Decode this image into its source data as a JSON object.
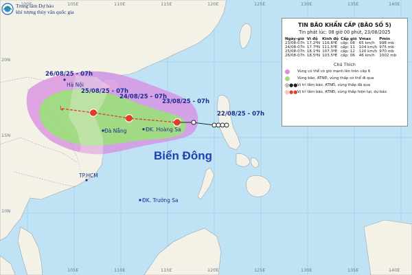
{
  "brand": {
    "line1": "Trung tâm Dự báo",
    "line2": "khí tượng thủy văn quốc gia"
  },
  "bulletin": {
    "title": "TIN BÃO KHẨN CẤP (BÃO SỐ 5)",
    "issued": "Tin phát lúc: 08 giờ 00 phút, 23/08/2025",
    "columns": [
      "Ngày-giờ",
      "Vĩ độ",
      "Kinh độ",
      "Cấp gió",
      "Vmax",
      "Pmin"
    ],
    "rows": [
      [
        "23/08-07h",
        "17.2ºN",
        "116.6ºE",
        "cấp: 08",
        "65 km/h",
        "998 mb"
      ],
      [
        "24/08-07h",
        "17.7ºN",
        "111.5ºE",
        "cấp: 11",
        "104 km/h",
        "975 mb"
      ],
      [
        "25/08-07h",
        "18.1ºN",
        "107.3ºE",
        "cấp: 12",
        "120 km/h",
        "970 mb"
      ],
      [
        "26/08-07h",
        "18.5ºN",
        "103.5ºE",
        "cấp: 06",
        "46 km/h",
        "1002 mb"
      ]
    ],
    "legend_title": "Chú Thích",
    "legend": [
      "Vùng có thể có gió mạnh lên trên cấp 6",
      "Vùng bão, ATNĐ, vùng thấp có thể đi qua",
      "Vị trí tâm bão, ATNĐ, vùng thấp đã qua",
      "Vị trí tâm bão, ATNĐ, vùng thấp hiện tại, dự báo"
    ]
  },
  "map": {
    "sea_name": "Biển Đông",
    "cities": [
      "Hà Nội",
      "Đà Nẵng",
      "TP.HCM"
    ],
    "islands": [
      "ĐK. Hoàng Sa",
      "ĐK. Trường Sa"
    ],
    "track_labels": [
      "26/08/25 - 07h",
      "25/08/25 - 07h",
      "24/08/25 - 07h",
      "23/08/25 - 07h",
      "22/08/25 - 07h"
    ],
    "lon_top": [
      "100E",
      "105E",
      "110E",
      "115E",
      "120E",
      "125E",
      "130E",
      "135E",
      "140E"
    ],
    "lon_bottom": [
      "105E",
      "110E",
      "115E",
      "120E",
      "125E",
      "130E",
      "135E",
      "140E"
    ],
    "lat_left": [
      "20N",
      "15N",
      "10N"
    ],
    "colors": {
      "sea": "#bfe3f5",
      "land": "#f4f1e6",
      "wind_zone": "#d98ee0",
      "storm_zone": "#9be07b",
      "track": "#e23b2d"
    }
  }
}
